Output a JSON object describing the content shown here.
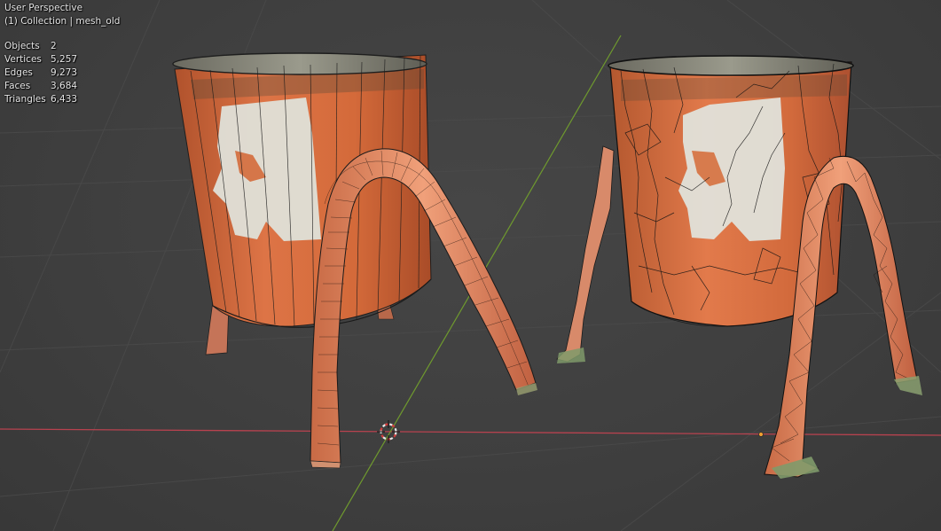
{
  "viewport": {
    "view_name": "User Perspective",
    "collection_line": "(1) Collection | mesh_old"
  },
  "stats": [
    {
      "label": "Objects",
      "value": "2"
    },
    {
      "label": "Vertices",
      "value": "5,257"
    },
    {
      "label": "Edges",
      "value": "9,273"
    },
    {
      "label": "Faces",
      "value": "3,684"
    },
    {
      "label": "Triangles",
      "value": "6,433"
    }
  ],
  "colors": {
    "background": "#3d3d3d",
    "grid": "#4a4a4a",
    "x_axis": "#c0404f",
    "y_axis": "#6a9a2a",
    "bucket_orange": "#d8703e",
    "wire": "#1a1a1a"
  },
  "icons": {
    "cursor": "3d-cursor-icon",
    "origin": "object-origin-icon"
  }
}
